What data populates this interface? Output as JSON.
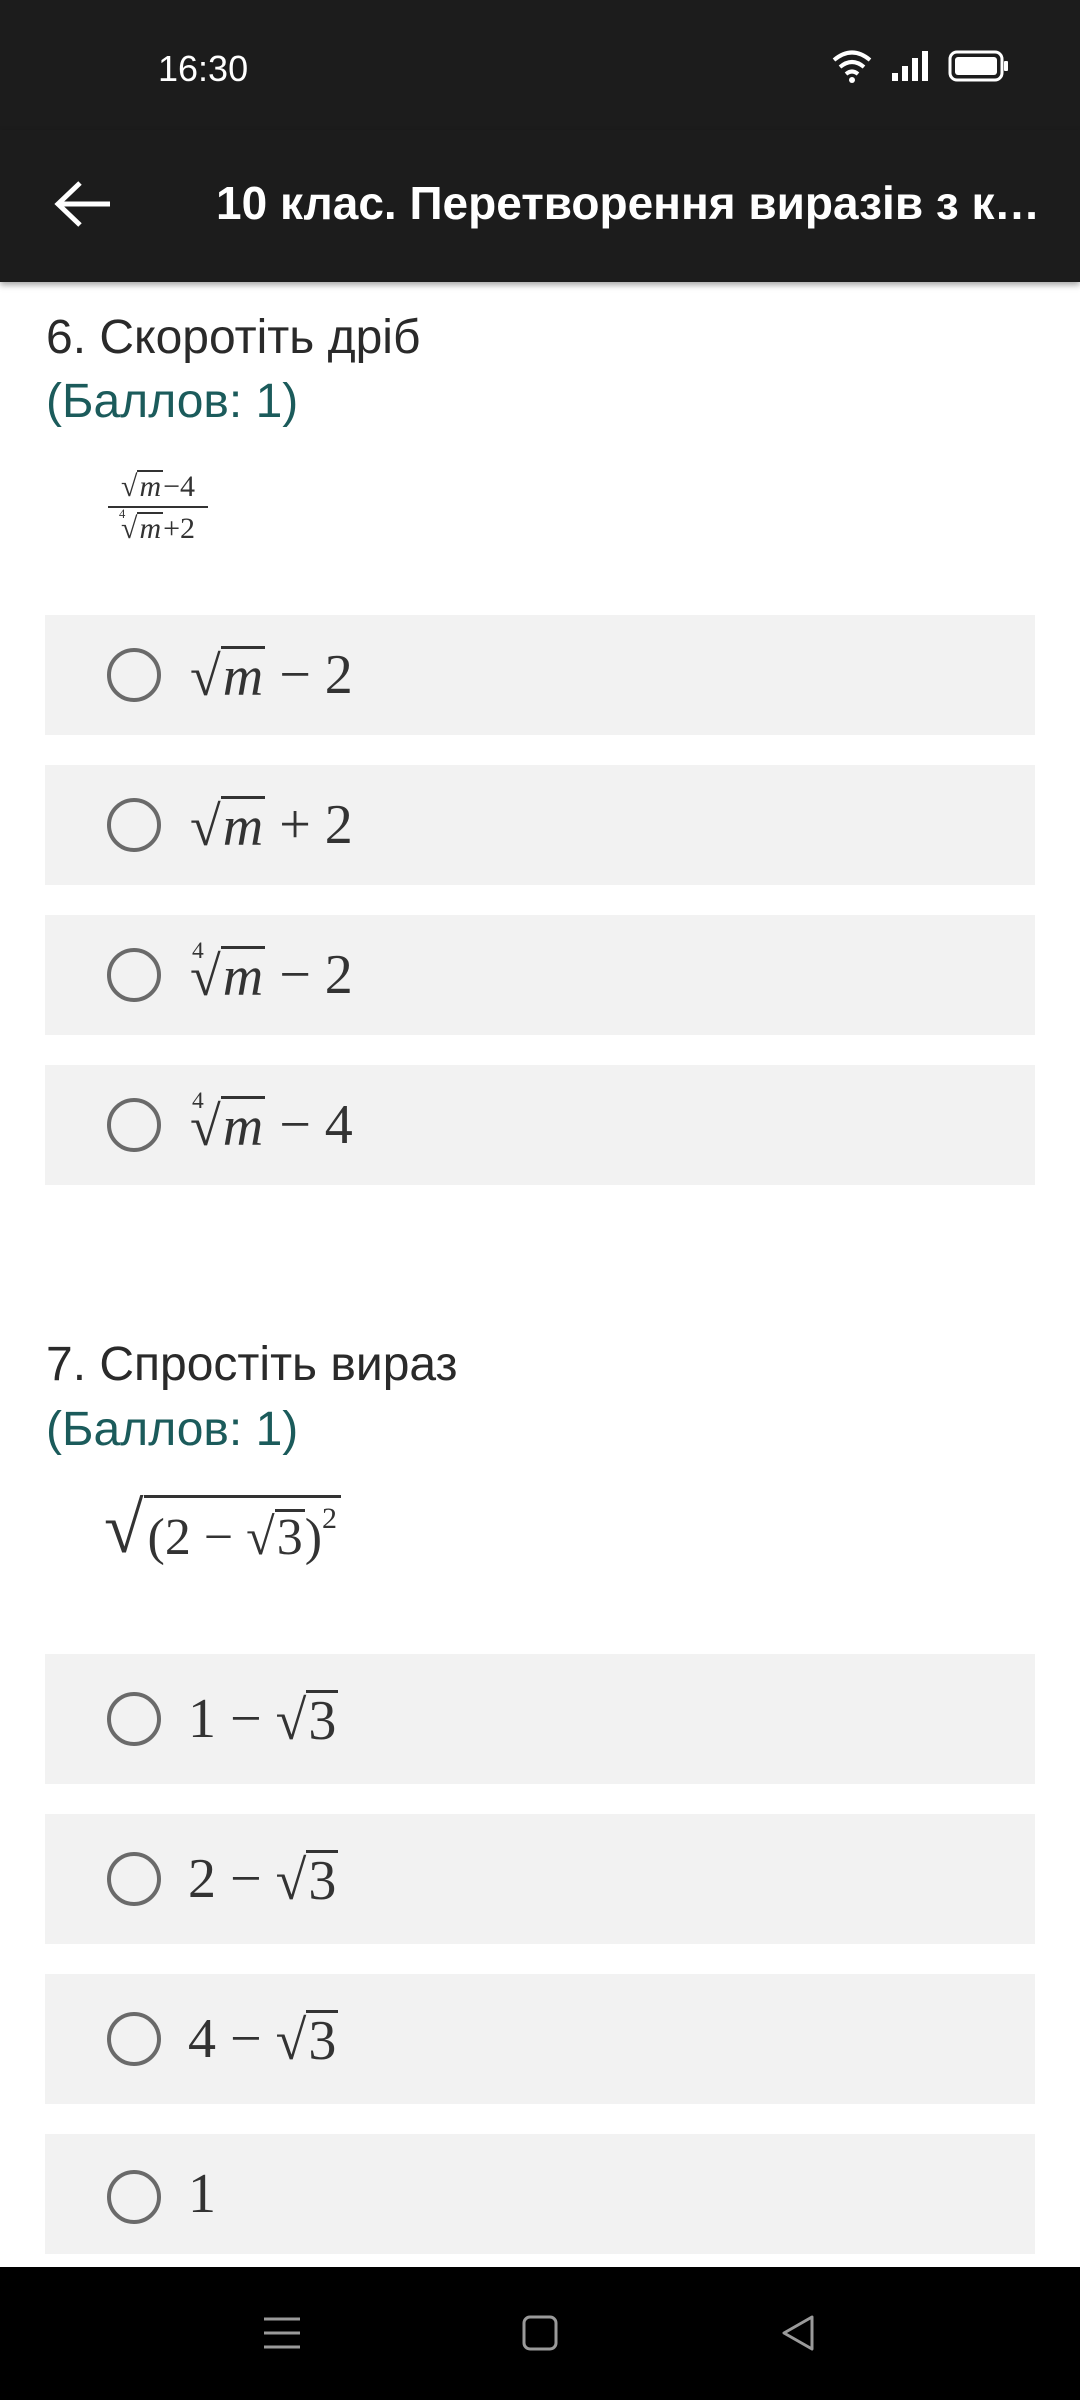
{
  "status_bar": {
    "time": "16:30"
  },
  "app_bar": {
    "title": "10 клас. Перетворення виразів з ко…"
  },
  "questions": [
    {
      "title": "6. Скоротіть дріб",
      "points": "(Баллов: 1)",
      "formula": {
        "numerator": "√m−4",
        "denominator": "⁴√m+2",
        "num_rad": "m",
        "num_rest": "−4",
        "den_index": "4",
        "den_rad": "m",
        "den_rest": "+2"
      },
      "options": [
        {
          "index": "",
          "radicand": "m",
          "rest": " − 2"
        },
        {
          "index": "",
          "radicand": "m",
          "rest": " + 2"
        },
        {
          "index": "4",
          "radicand": "m",
          "rest": " − 2"
        },
        {
          "index": "4",
          "radicand": "m",
          "rest": " − 4"
        }
      ]
    },
    {
      "title": "7. Спростіть вираз",
      "points": "(Баллов: 1)",
      "formula": {
        "inner_left": "(2 − ",
        "inner_rad": "3",
        "inner_right": ")",
        "exponent": "2"
      },
      "options": [
        {
          "prefix": "1 − ",
          "radicand": "3"
        },
        {
          "prefix": "2 − ",
          "radicand": "3"
        },
        {
          "prefix": "4 − ",
          "radicand": "3"
        },
        {
          "prefix": "1",
          "radicand": ""
        }
      ]
    }
  ],
  "icons": {
    "back": "arrow-left-icon",
    "wifi": "wifi-icon",
    "signal": "signal-icon",
    "battery": "battery-icon",
    "nav_menu": "menu-icon",
    "nav_home": "home-icon",
    "nav_back": "back-triangle-icon"
  },
  "colors": {
    "bar": "#1c1c1c",
    "points": "#1b5b5b",
    "option_bg": "#f2f2f2"
  }
}
